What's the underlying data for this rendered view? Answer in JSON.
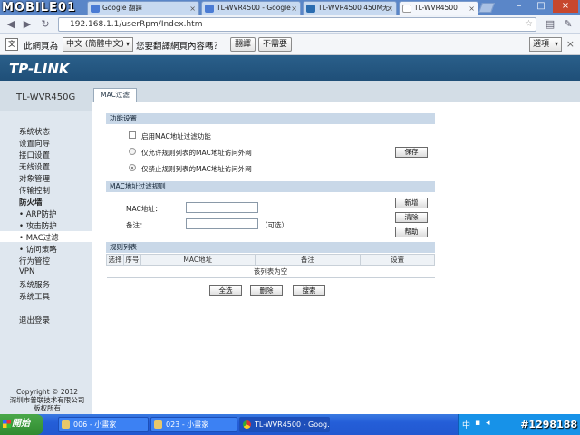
{
  "browser": {
    "watermark_logo": "MOBILE01",
    "tabs": [
      {
        "label": "Google 翻譯",
        "color": "#4a7bd4"
      },
      {
        "label": "TL-WVR4500 - Google",
        "color": "#4a7bd4"
      },
      {
        "label": "TL-WVR4500 450M无·",
        "color": "#2a6cb0"
      },
      {
        "label": "TL-WVR4500",
        "color": "#ffffff"
      }
    ],
    "url": "192.168.1.1/userRpm/Index.htm",
    "translate_bar": {
      "prefix": "此網頁為",
      "language": "中文 (簡體中文)",
      "question": "您要翻譯網頁內容嗎？",
      "translate_btn": "翻譯",
      "decline_btn": "不需要",
      "options_btn": "選項"
    }
  },
  "page": {
    "logo": "TP-LINK",
    "model": "TL-WVR450G",
    "active_tab": "MAC过滤",
    "sidebar": {
      "items": [
        "系统状态",
        "设置向导",
        "接口设置",
        "无线设置",
        "对象管理",
        "传输控制"
      ],
      "section": "防火墙",
      "sub_items": [
        "• ARP防护",
        "• 攻击防护",
        "• MAC过滤",
        "• 访问策略"
      ],
      "items2": [
        "行为管控",
        "VPN",
        "系统服务",
        "系统工具"
      ],
      "logout": "退出登录",
      "copyright": [
        "Copyright © 2012",
        "深圳市普联技术有限公司",
        "版权所有"
      ]
    },
    "func_settings": {
      "title": "功能设置",
      "enable_label": "启用MAC地址过滤功能",
      "allow_label": "仅允许规则列表的MAC地址访问外网",
      "deny_label": "仅禁止规则列表的MAC地址访问外网",
      "save_btn": "保存"
    },
    "rule_form": {
      "title": "MAC地址过滤规则",
      "mac_label": "MAC地址：",
      "note_label": "备注：",
      "optional": "（可选）",
      "add_btn": "新增",
      "clear_btn": "清除",
      "help_btn": "帮助"
    },
    "rule_list": {
      "title": "规则列表",
      "columns": [
        "选择",
        "序号",
        "MAC地址",
        "备注",
        "设置"
      ],
      "empty_text": "该列表为空",
      "select_all_btn": "全选",
      "delete_btn": "删除",
      "search_btn": "搜索"
    }
  },
  "taskbar": {
    "start": "開始",
    "tasks": [
      "006 - 小畫家",
      "023 - 小畫家",
      "TL-WVR4500 - Goog..."
    ],
    "tray_lang": "中",
    "watermark": "#1298188"
  }
}
